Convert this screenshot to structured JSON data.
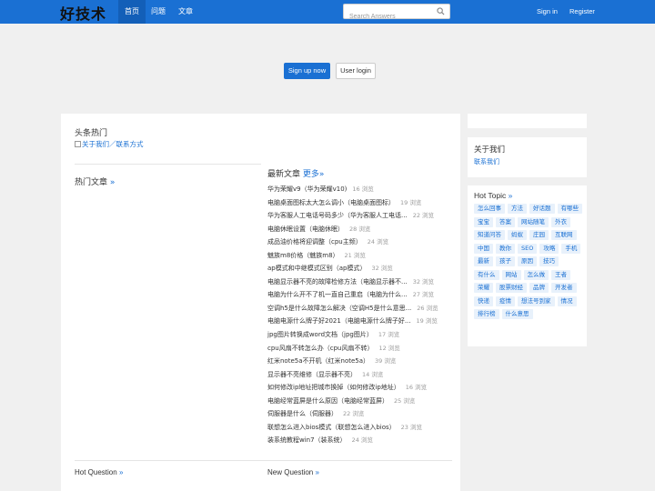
{
  "header": {
    "brand": "好技术",
    "nav": [
      "首页",
      "问题",
      "文章"
    ],
    "search_placeholder": "Search Answers",
    "signin": "Sign in",
    "register": "Register"
  },
  "hero": {
    "signup": "Sign up now",
    "login": "User login"
  },
  "main": {
    "headline_title": "头条热门",
    "headline_link": "关于我们／联系方式",
    "hot_articles": "热门文章",
    "hot_articles_more": "»",
    "latest_title": "最新文章",
    "latest_more": "更多»",
    "articles": [
      {
        "title": "华为荣耀v9（华为荣耀v10)",
        "views": "16 浏览"
      },
      {
        "title": "电脑桌面图标太大怎么调小（电脑桌面图标）",
        "views": "19 浏览"
      },
      {
        "title": "华为客服人工电话号码多少（华为客服人工电话...",
        "views": "22 浏览"
      },
      {
        "title": "电脑休眠设置（电脑休眠）",
        "views": "28 浏览"
      },
      {
        "title": "成品油价格将迎调整（cpu主频）",
        "views": "24 浏览"
      },
      {
        "title": "魅族m8价格（魅族m8）",
        "views": "21 浏览"
      },
      {
        "title": "ap模式和中继模式区别（ap模式）",
        "views": "32 浏览"
      },
      {
        "title": "电脑显示器不亮的故障检修方法（电脑显示器不...",
        "views": "32 浏览"
      },
      {
        "title": "电脑为什么开不了机一直自己重启（电脑为什么...",
        "views": "27 浏览"
      },
      {
        "title": "空调h5是什么故障怎么解决（空调H5是什么意思...",
        "views": "26 浏览"
      },
      {
        "title": "电脑电源什么牌子好2021（电脑电源什么牌子好...",
        "views": "19 浏览"
      },
      {
        "title": "jpg图片转换成word文档（jpg图片）",
        "views": "17 浏览"
      },
      {
        "title": "cpu风扇不转怎么办（cpu风扇不转）",
        "views": "12 浏览"
      },
      {
        "title": "红米note5a不开机（红米note5a）",
        "views": "39 浏览"
      },
      {
        "title": "显示器不亮维修（显示器不亮）",
        "views": "14 浏览"
      },
      {
        "title": "如何修改ip地址把城市换掉（如何修改ip地址）",
        "views": "16 浏览"
      },
      {
        "title": "电脑经常蓝屏是什么原因（电脑经常蓝屏）",
        "views": "25 浏览"
      },
      {
        "title": "伺服器是什么（伺服器）",
        "views": "22 浏览"
      },
      {
        "title": "联想怎么进入bios模式（联想怎么进入bios）",
        "views": "23 浏览"
      },
      {
        "title": "装系统教程win7（装系统）",
        "views": "24 浏览"
      }
    ],
    "hot_question": "Hot Question",
    "new_question": "New Question",
    "question_more": "»"
  },
  "sidebar": {
    "about_title": "关于我们",
    "about_link": "联系我们",
    "topic_title": "Hot Topic",
    "topic_more": "»",
    "tags": [
      "怎么回事",
      "方法",
      "好话题",
      "有哪些",
      "宝宝",
      "答案",
      "网站随笔",
      "外衣",
      "知道问答",
      "蚂蚁",
      "庄园",
      "互联网",
      "中国",
      "教你",
      "SEO",
      "攻略",
      "手机",
      "最新",
      "孩子",
      "原因",
      "技巧",
      "有什么",
      "网站",
      "怎么做",
      "王者",
      "荣耀",
      "股票财经",
      "品牌",
      "开发者",
      "快递",
      "疫情",
      "想法号到家",
      "情况",
      "排行榜",
      "什么意思"
    ]
  },
  "colors": {
    "accent": "#1a70d3",
    "background": "#f0f0f0"
  }
}
